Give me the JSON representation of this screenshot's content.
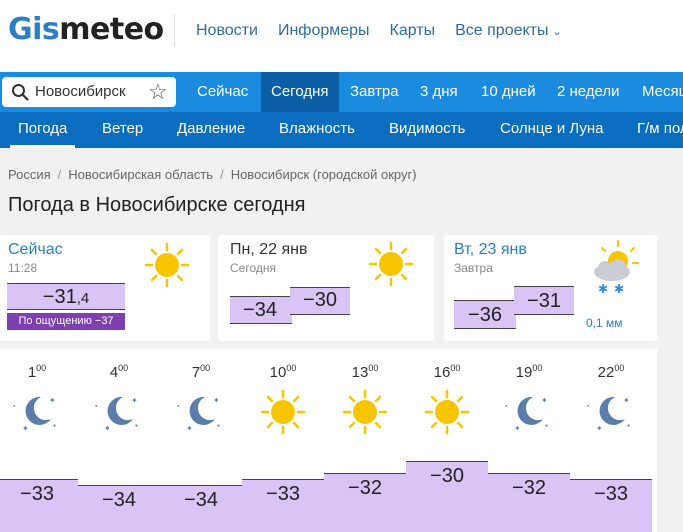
{
  "header": {
    "logo_part1": "Gis",
    "logo_part2": "meteo",
    "nav": [
      "Новости",
      "Информеры",
      "Карты",
      "Все проекты"
    ]
  },
  "search": {
    "value": "Новосибирск"
  },
  "tabs": [
    "Сейчас",
    "Сегодня",
    "Завтра",
    "3 дня",
    "10 дней",
    "2 недели",
    "Месяц"
  ],
  "active_tab": "Сегодня",
  "subnav": [
    "Погода",
    "Ветер",
    "Давление",
    "Влажность",
    "Видимость",
    "Солнце и Луна",
    "Г/м поле"
  ],
  "active_subnav": "Погода",
  "breadcrumb": [
    "Россия",
    "Новосибирская область",
    "Новосибирск (городской округ)"
  ],
  "page_title": "Погода в Новосибирске сегодня",
  "now": {
    "label": "Сейчас",
    "time": "11:28",
    "temp_int": "−31",
    "temp_frac": ",4",
    "feels_label": "По ощущению",
    "feels_value": "−37",
    "icon": "sun-icon"
  },
  "today": {
    "date": "Пн, 22 янв",
    "label": "Сегодня",
    "temp_min": "−34",
    "temp_max": "−30",
    "icon": "sun-icon"
  },
  "tomorrow": {
    "date": "Вт, 23 янв",
    "label": "Завтра",
    "temp_min": "−36",
    "temp_max": "−31",
    "precip": "0,1 мм",
    "icon": "sun-cloud-snow-icon"
  },
  "hourly": [
    {
      "hour": "1",
      "min": "00",
      "icon": "moon-icon",
      "temp": "−33",
      "value": -33
    },
    {
      "hour": "4",
      "min": "00",
      "icon": "moon-icon",
      "temp": "−34",
      "value": -34
    },
    {
      "hour": "7",
      "min": "00",
      "icon": "moon-icon",
      "temp": "−34",
      "value": -34
    },
    {
      "hour": "10",
      "min": "00",
      "icon": "sun-icon",
      "temp": "−33",
      "value": -33
    },
    {
      "hour": "13",
      "min": "00",
      "icon": "sun-icon",
      "temp": "−32",
      "value": -32
    },
    {
      "hour": "16",
      "min": "00",
      "icon": "sun-icon",
      "temp": "−30",
      "value": -30
    },
    {
      "hour": "19",
      "min": "00",
      "icon": "moon-icon",
      "temp": "−32",
      "value": -32
    },
    {
      "hour": "22",
      "min": "00",
      "icon": "moon-icon",
      "temp": "−33",
      "value": -33
    }
  ],
  "colors": {
    "brand": "#2a7fc7",
    "tabbar": "#1a8bdf",
    "subnav": "#0a6dbf",
    "temp_fill": "#d8c4f5",
    "feels_bg": "#7e3fb1",
    "sun": "#f7c600",
    "moon": "#5b7daa"
  }
}
